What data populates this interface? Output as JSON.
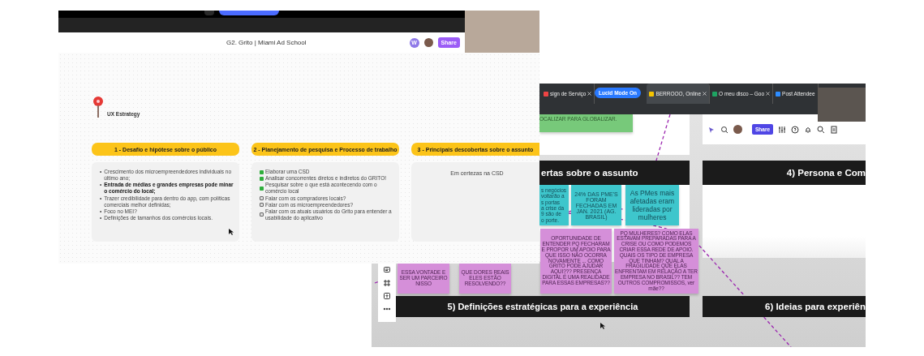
{
  "front_window": {
    "title": "G2. Grito | Miami Ad School",
    "avatar_initial": "W",
    "share": "Share",
    "slide": {
      "logo_text": "UX Estrategy",
      "columns": [
        {
          "kind": "bullets",
          "heading": "1 - Desafio e hipótese sobre o público",
          "marker": "•",
          "items": [
            {
              "text": "Crescimento dos microempreendedores individuais no último ano;",
              "bold": false
            },
            {
              "text": "Entrada de médias e grandes empresas pode minar o comércio do local;",
              "bold": true
            },
            {
              "text": "Trazer credibilidade para dentro do app, com políticas comerciais melhor definidas;",
              "bold": false
            },
            {
              "text": "Foco no MEI?",
              "bold": false
            },
            {
              "text": "Definições de tamanhos dos comércios locais.",
              "bold": false
            }
          ]
        },
        {
          "kind": "checklist",
          "heading": "2 - Planejamento de pesquisa e Processo de trabalho",
          "items": [
            {
              "text": "Elaborar uma CSD",
              "checked": true
            },
            {
              "text": "Analisar concorrentes diretos e indiretos do GRITO!",
              "checked": true
            },
            {
              "text": "Pesquisar sobre o que está acontecendo com o comércio local",
              "checked": true
            },
            {
              "text": "Falar com os compradores locais?",
              "checked": false
            },
            {
              "text": "Falar com os microempreendedores?",
              "checked": false
            },
            {
              "text": "Falar com os atuais usuários do Grito para entender a usabilidade do aplicativo",
              "checked": false
            }
          ]
        },
        {
          "kind": "note",
          "heading": "3 - Principais descobertas sobre o assunto",
          "text": "Em certezas na CSD"
        }
      ]
    }
  },
  "back_window": {
    "tabs": [
      {
        "label": "sign de Serviço",
        "selected": false
      },
      {
        "label": "BERROOO, Online",
        "selected": true
      },
      {
        "label": "O meu disco – Goo",
        "selected": false
      },
      {
        "label": "Post Attendee",
        "selected": false
      }
    ],
    "mode_badge": "Lucid Mode On",
    "share": "Share",
    "green_note": "OCALIZAR PARA GLOBALIZAR.",
    "section_headers": [
      "ertas sobre o assunto",
      "4)  Persona e Com",
      "5) Definições estratégicas para a experiência",
      "6) Ideias para experiên"
    ],
    "teal_notes": [
      "s negócios\nvoltarão a\ns portas\na crise da\n9 são de\no porte.",
      "24% DAS PME'S FORAM FECHADAS EM JAN. 2021 (AG. BRASIL)",
      "As PMes mais afetadas eram lideradas por mulheres"
    ],
    "pink_notes": [
      "ESSA VONTADE E SER UM PARCEIRO NISSO",
      "QUE DORES REAIS ELES ESTÃO RESOLVENDO??",
      "OPORTUNIDADE DE ENTENDER PQ FECHARAM E PROPOR UM APOIO PARA QUE ISSO NÃO OCORRA NOVAMENTE ... COMO GRITO PODE AJUDAR AQUI??? PRESENÇA DIGITAL É UMA REALIDADE PARA ESSAS EMPRESAS??",
      "PQ MULHERES? COMO ELAS ESTAVAM PREPARADAS PARA A CRISE OU COMO PODEMOS CRIAR ESSA REDE DE APOIO. QUAIS OS TIPO DE EMPRESA QUE TINHAM? QUAL A FRAGILIDADE QUE ELAS ENFRENTAM EM RELAÇÃO A TER EMPRESA NO BRASIL?? TEM OUTROS COMPROMISSOS, ver mãe??"
    ]
  }
}
